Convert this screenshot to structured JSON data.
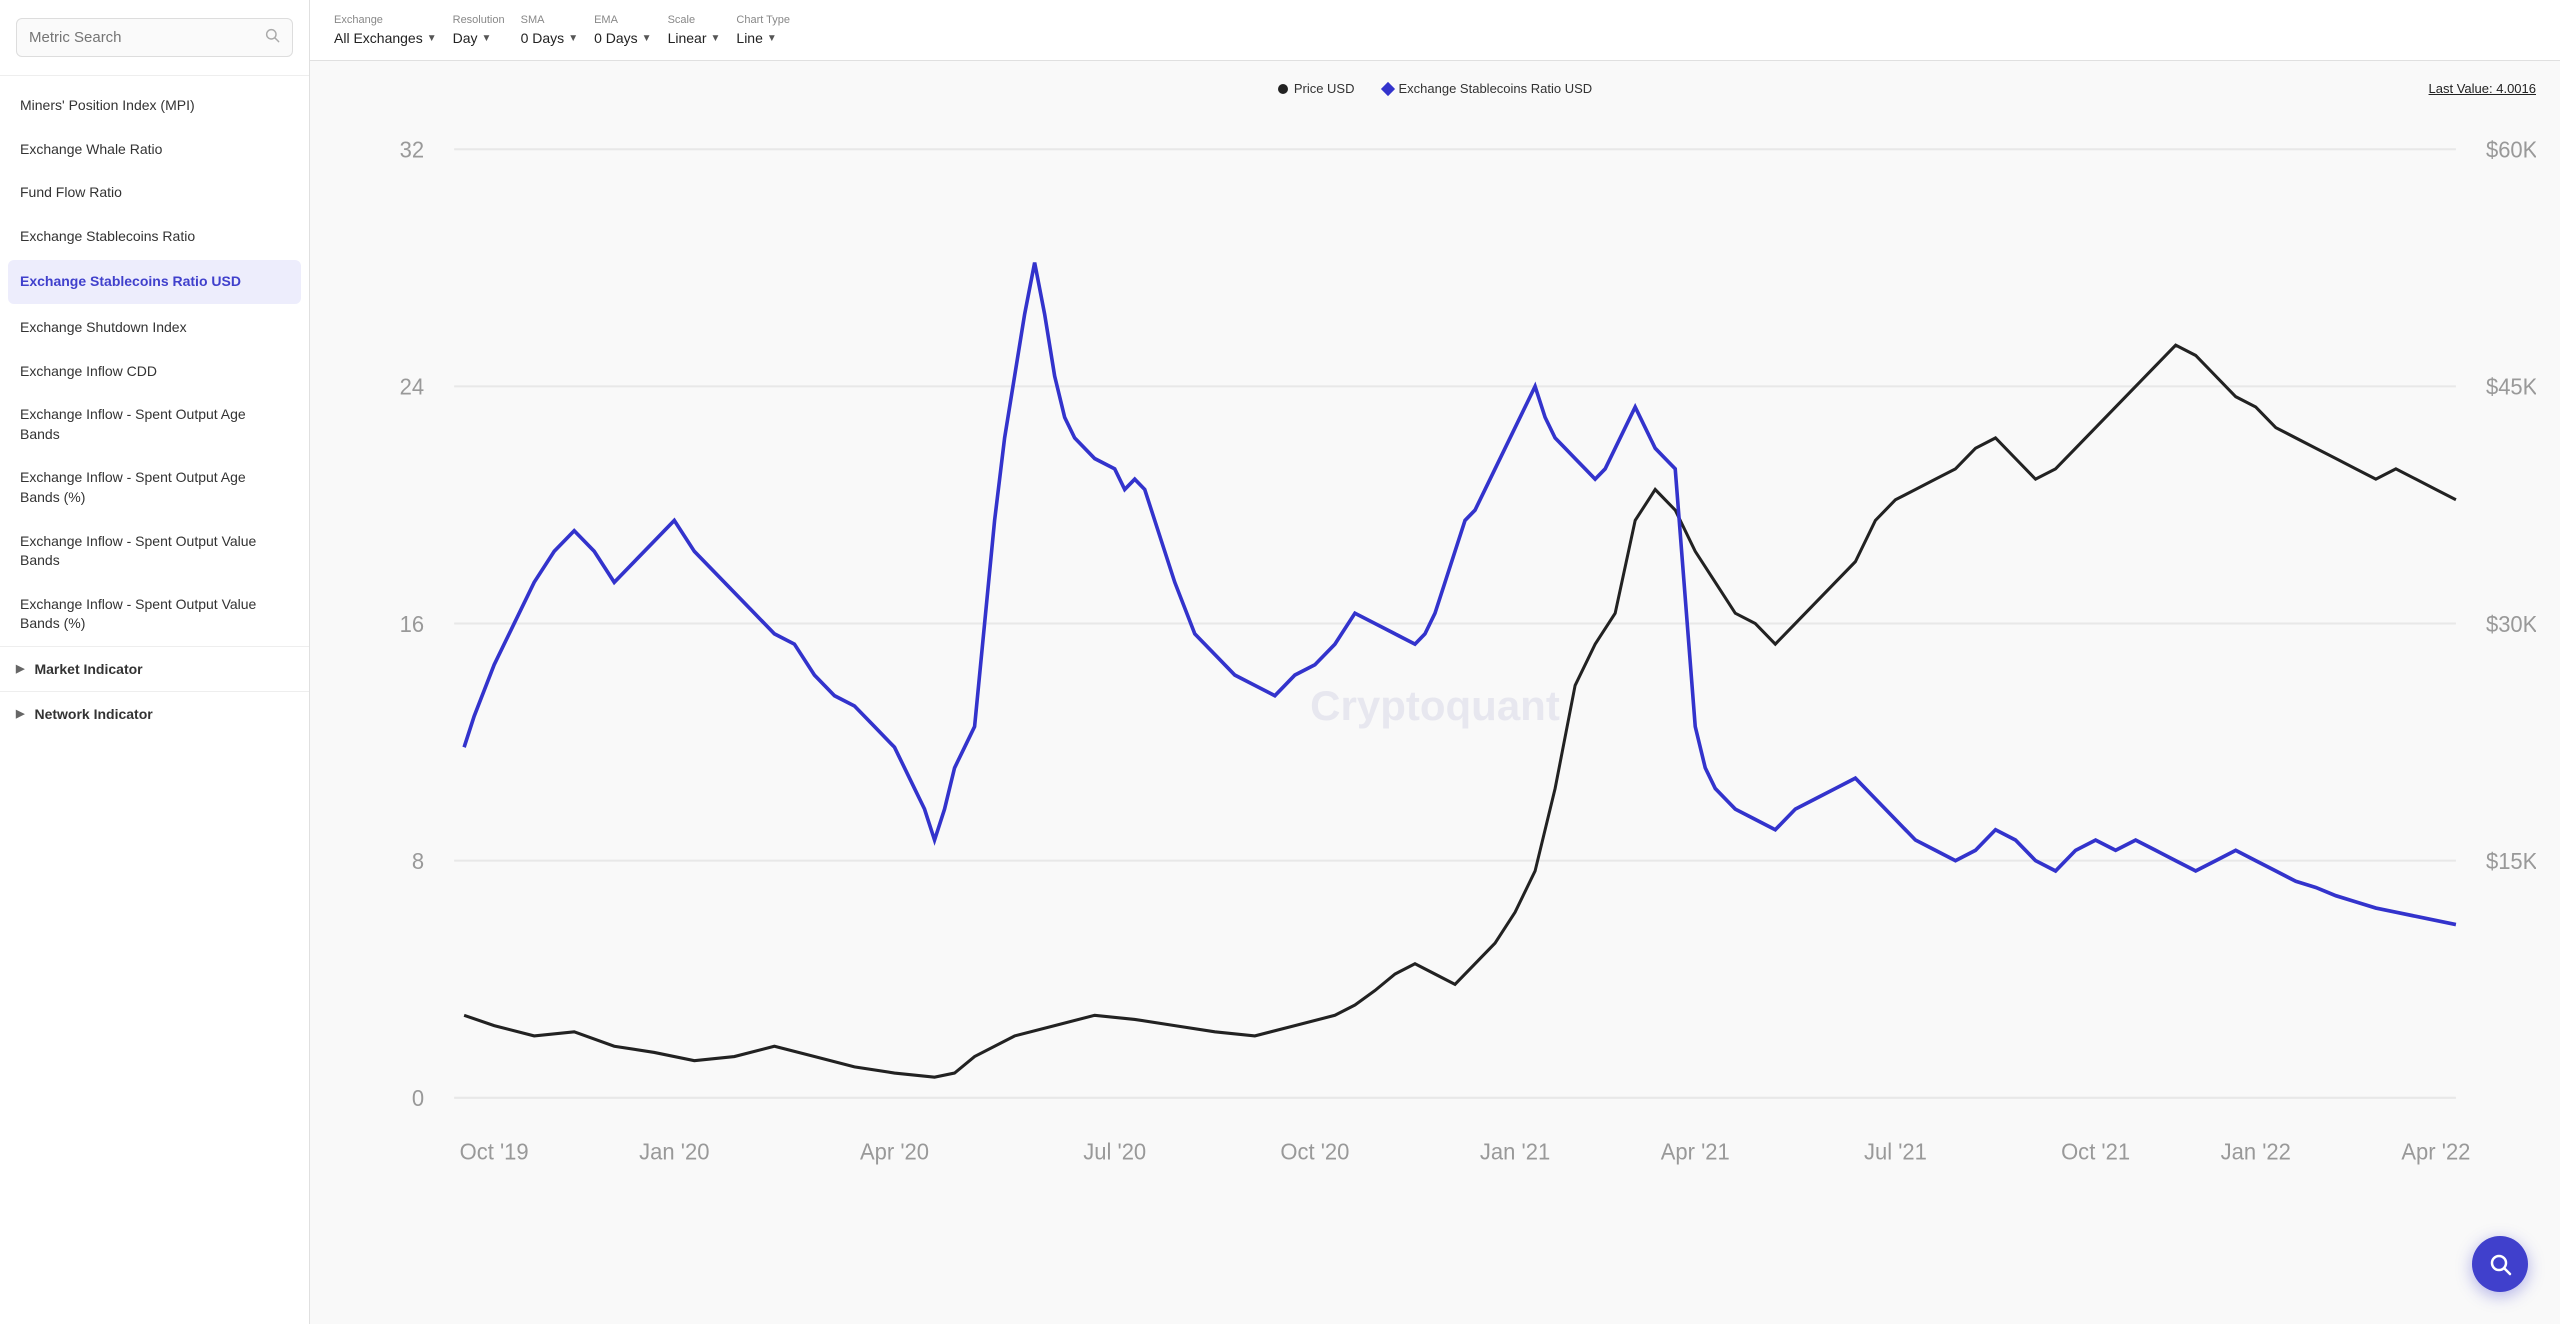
{
  "sidebar": {
    "search_placeholder": "Metric Search",
    "items": [
      {
        "id": "miners-position-index",
        "label": "Miners' Position Index (MPI)",
        "active": false
      },
      {
        "id": "exchange-whale-ratio",
        "label": "Exchange Whale Ratio",
        "active": false
      },
      {
        "id": "fund-flow-ratio",
        "label": "Fund Flow Ratio",
        "active": false
      },
      {
        "id": "exchange-stablecoins-ratio",
        "label": "Exchange Stablecoins Ratio",
        "active": false
      },
      {
        "id": "exchange-stablecoins-ratio-usd",
        "label": "Exchange Stablecoins Ratio USD",
        "active": true
      },
      {
        "id": "exchange-shutdown-index",
        "label": "Exchange Shutdown Index",
        "active": false
      },
      {
        "id": "exchange-inflow-cdd",
        "label": "Exchange Inflow CDD",
        "active": false
      },
      {
        "id": "exchange-inflow-spent-age-bands",
        "label": "Exchange Inflow - Spent Output Age Bands",
        "active": false
      },
      {
        "id": "exchange-inflow-spent-age-bands-pct",
        "label": "Exchange Inflow - Spent Output Age Bands (%)",
        "active": false
      },
      {
        "id": "exchange-inflow-spent-value-bands",
        "label": "Exchange Inflow - Spent Output Value Bands",
        "active": false
      },
      {
        "id": "exchange-inflow-spent-value-bands-pct",
        "label": "Exchange Inflow - Spent Output Value Bands (%)",
        "active": false
      }
    ],
    "sections": [
      {
        "id": "market-indicator",
        "label": "Market Indicator"
      },
      {
        "id": "network-indicator",
        "label": "Network Indicator"
      }
    ]
  },
  "controls": {
    "exchange": {
      "label": "Exchange",
      "value": "All Exchanges"
    },
    "resolution": {
      "label": "Resolution",
      "value": "Day"
    },
    "sma": {
      "label": "SMA",
      "value": "0 Days"
    },
    "ema": {
      "label": "EMA",
      "value": "0 Days"
    },
    "scale": {
      "label": "Scale",
      "value": "Linear"
    },
    "chart_type": {
      "label": "Chart Type",
      "value": "Line"
    }
  },
  "chart": {
    "legend": {
      "price_label": "Price USD",
      "ratio_label": "Exchange Stablecoins Ratio USD"
    },
    "last_value_label": "Last Value: 4.0016",
    "watermark": "Cryptoquant",
    "y_axis_left": [
      "0",
      "8",
      "16",
      "24",
      "32"
    ],
    "y_axis_right": [
      "$15K",
      "$30K",
      "$45K",
      "$60K"
    ],
    "x_axis": [
      "Oct '19",
      "Jan '20",
      "Apr '20",
      "Jul '20",
      "Oct '20",
      "Jan '21",
      "Apr '21",
      "Jul '21",
      "Oct '21",
      "Jan '22",
      "Apr '22"
    ]
  },
  "fab": {
    "icon": "search"
  }
}
